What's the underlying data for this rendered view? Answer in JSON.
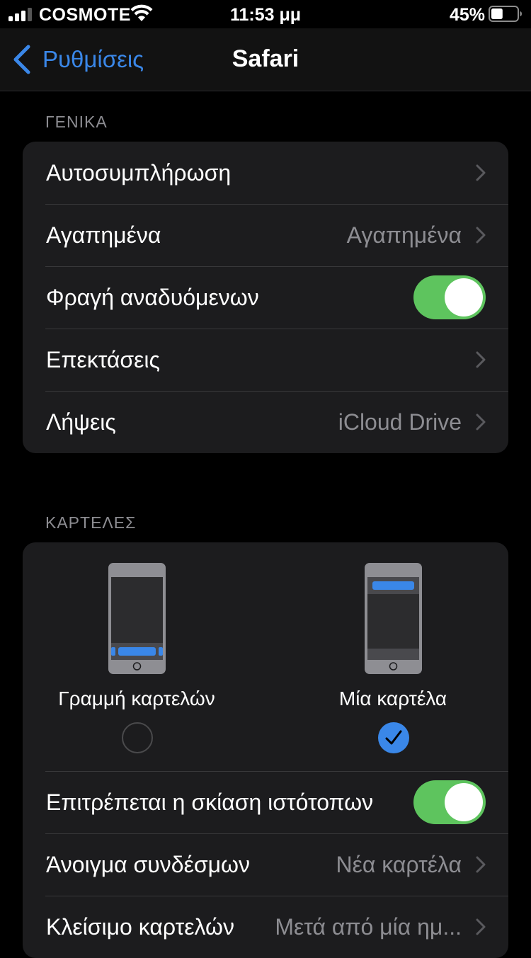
{
  "status_bar": {
    "carrier": "COSMOTE",
    "time": "11:53 μμ",
    "battery_percent": "45%",
    "battery_level": 0.45,
    "signal_bars": 3
  },
  "nav": {
    "back_label": "Ρυθμίσεις",
    "title": "Safari"
  },
  "general": {
    "header": "ΓΕΝΙΚΑ",
    "rows": [
      {
        "label": "Αυτοσυμπλήρωση",
        "value": "",
        "type": "disclosure"
      },
      {
        "label": "Αγαπημένα",
        "value": "Αγαπημένα",
        "type": "disclosure"
      },
      {
        "label": "Φραγή αναδυόμενων",
        "type": "toggle",
        "on": true
      },
      {
        "label": "Επεκτάσεις",
        "value": "",
        "type": "disclosure"
      },
      {
        "label": "Λήψεις",
        "value": "iCloud Drive",
        "type": "disclosure"
      }
    ]
  },
  "tabs": {
    "header": "ΚΑΡΤΕΛΕΣ",
    "layout_options": [
      {
        "label": "Γραμμή καρτελών",
        "selected": false
      },
      {
        "label": "Μία καρτέλα",
        "selected": true
      }
    ],
    "rows": [
      {
        "label": "Επιτρέπεται η σκίαση ιστότοπων",
        "type": "toggle",
        "on": true
      },
      {
        "label": "Άνοιγμα συνδέσμων",
        "value": "Νέα καρτέλα",
        "type": "disclosure"
      },
      {
        "label": "Κλείσιμο καρτελών",
        "value": "Μετά από μία ημ...",
        "type": "disclosure"
      }
    ]
  },
  "colors": {
    "accent": "#3a87e8",
    "toggle_on": "#5ec45e",
    "background": "#000000",
    "group_background": "#1c1c1e",
    "secondary_text": "#8d8d92"
  }
}
